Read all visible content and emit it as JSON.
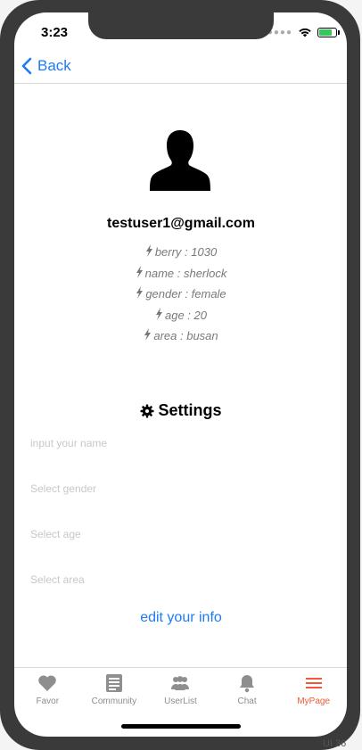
{
  "status": {
    "time": "3:23"
  },
  "nav": {
    "back_label": "Back"
  },
  "profile": {
    "email": "testuser1@gmail.com",
    "details": [
      "berry : 1030",
      "name : sherlock",
      "gender : female",
      "age : 20",
      "area : busan"
    ]
  },
  "settings": {
    "title": "Settings",
    "name_placeholder": "input your name",
    "gender_placeholder": "Select gender",
    "age_placeholder": "Select age",
    "area_placeholder": "Select area",
    "edit_label": "edit your info"
  },
  "tabs": [
    {
      "label": "Favor",
      "icon": "heart-icon"
    },
    {
      "label": "Community",
      "icon": "document-icon"
    },
    {
      "label": "UserList",
      "icon": "users-icon"
    },
    {
      "label": "Chat",
      "icon": "bell-icon"
    },
    {
      "label": "MyPage",
      "icon": "menu-icon",
      "active": true
    }
  ],
  "colors": {
    "accent": "#1e7cf2",
    "active_tab": "#f05a3a",
    "battery": "#34c759"
  },
  "edge_text": "UI 36"
}
